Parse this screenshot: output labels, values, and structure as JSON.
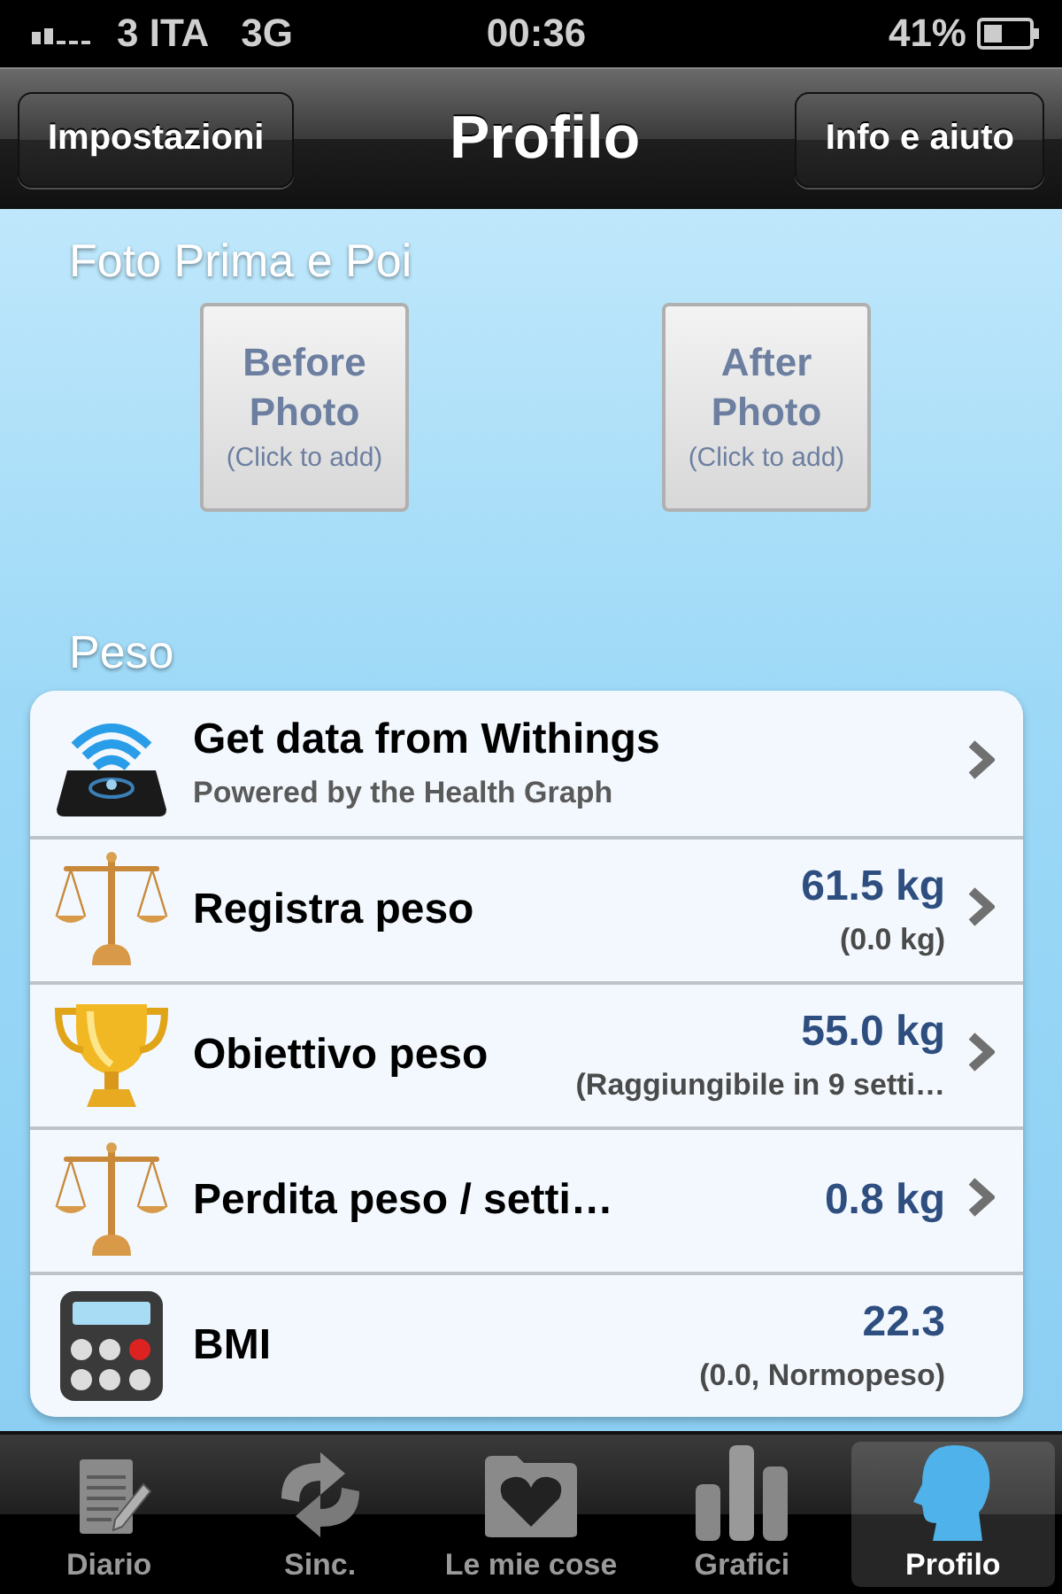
{
  "status_bar": {
    "carrier": "3 ITA",
    "network": "3G",
    "time": "00:36",
    "battery": "41%"
  },
  "nav_bar": {
    "left_button": "Impostazioni",
    "title": "Profilo",
    "right_button": "Info e aiuto"
  },
  "photos": {
    "heading": "Foto Prima e Poi",
    "buttons": [
      {
        "title": "Before Photo",
        "hint": "(Click to add)"
      },
      {
        "title": "After Photo",
        "hint": "(Click to add)"
      }
    ]
  },
  "weight": {
    "heading": "Peso",
    "rows": [
      {
        "title": "Get data from Withings",
        "subtitle": "Powered by the Health Graph",
        "chevron": true
      },
      {
        "title": "Registra peso",
        "value": "61.5 kg",
        "note": "(0.0 kg)",
        "chevron": true
      },
      {
        "title": "Obiettivo peso",
        "value": "55.0 kg",
        "note": "(Raggiungibile in 9 setti…",
        "chevron": true
      },
      {
        "title": "Perdita peso / setti…",
        "value": "0.8 kg",
        "chevron": true
      },
      {
        "title": "BMI",
        "value": "22.3",
        "note": "(0.0, Normopeso)",
        "chevron": false
      }
    ]
  },
  "tab_bar": [
    {
      "label": "Diario",
      "selected": false
    },
    {
      "label": "Sinc.",
      "selected": false
    },
    {
      "label": "Le mie cose",
      "selected": false
    },
    {
      "label": "Grafici",
      "selected": false
    },
    {
      "label": "Profilo",
      "selected": true
    }
  ]
}
